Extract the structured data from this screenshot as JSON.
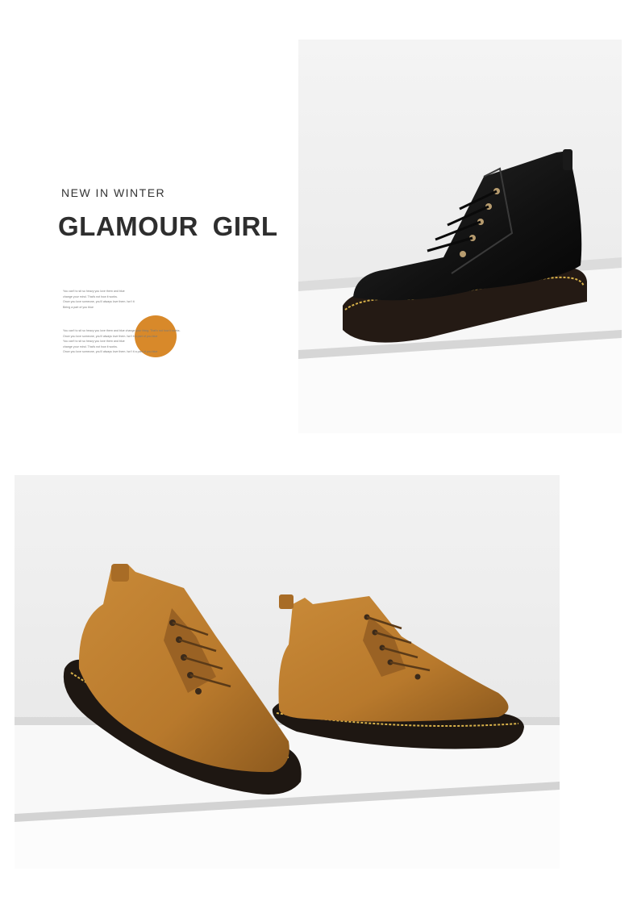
{
  "header": {
    "subtitle": "NEW IN WINTER",
    "title": "GLAMOUR GIRL"
  },
  "blurb": {
    "block1": [
      "You can't to sit so heavy you love them and blue",
      "change your mind. That's not how it works.",
      "Once you love someone, you'll always love them. Isn't it",
      "",
      "Being a part of you blue"
    ],
    "block2": [
      "You can't to sit so heavy you love them and blue change your thing. That's not how it works.",
      "Once you love someone, you'll always love them. Isn't it a part of you blue",
      "You can't to sit so heavy you love them and blue",
      "change your mind. That's not how it works.",
      "Once you love someone, you'll always love them. Isn't it a part of you blue"
    ]
  },
  "colors": {
    "accent": "#d8892a",
    "black_boot": "#161616",
    "tan_boot": "#b8792c",
    "stitch": "#d9b24a"
  },
  "images": {
    "top_photo": "black-leather-ankle-boot-on-white-steps",
    "bottom_photo": "pair-of-tan-leather-ankle-boots-on-white-steps"
  }
}
